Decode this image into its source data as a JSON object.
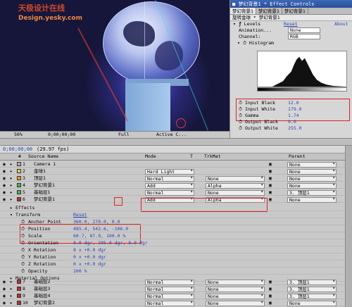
{
  "watermark": {
    "line1": "天极设计在线",
    "line2": "Design.yesky.com"
  },
  "composition": {
    "zoom": "50%",
    "timecode": "0;00;00;00",
    "quality": "Full",
    "camera": "Active C..."
  },
  "effect_controls": {
    "title": "梦幻背景1 * Effect Controls",
    "tabs": [
      "梦幻背景1",
      "梦幻背景1",
      "梦幻背景1"
    ],
    "breadcrumb": "旋转金球 * 梦幻背景1",
    "levels_label": "Levels",
    "reset": "Reset",
    "about": "About",
    "animation_presets_label": "Animation...",
    "animation_presets_value": "None",
    "channel_label": "Channel:",
    "channel_value": "RGB",
    "histogram_label": "Histogram",
    "params": [
      {
        "label": "Input Black",
        "value": "12.0"
      },
      {
        "label": "Input White",
        "value": "179.0"
      },
      {
        "label": "Gamma",
        "value": "1.74"
      },
      {
        "label": "Output Black",
        "value": "0.0"
      },
      {
        "label": "Output White",
        "value": "255.0"
      }
    ]
  },
  "timeline": {
    "time": "0;00;00;00",
    "fps": "(29.97 fps)",
    "columns": {
      "num": "#",
      "source": "Source Name",
      "mode": "Mode",
      "t": "T",
      "trkmat": "TrkMat",
      "parent": "Parent"
    },
    "layers": [
      {
        "num": "1",
        "name": "Camera 1",
        "mode": "",
        "trkmat": "",
        "parent": "None",
        "color": "#c8a4a4"
      },
      {
        "num": "2",
        "name": "金球1",
        "mode": "Hard Light",
        "trkmat": "",
        "parent": "None",
        "color": "#e6c84a"
      },
      {
        "num": "3",
        "name": "顶层1",
        "mode": "Normal",
        "trkmat": "None",
        "parent": "None",
        "color": "#ff9a00"
      },
      {
        "num": "4",
        "name": "梦幻背景1",
        "mode": "Add",
        "trkmat": "Alpha",
        "parent": "None",
        "color": "#48b848"
      },
      {
        "num": "5",
        "name": "基础层1",
        "mode": "Normal",
        "trkmat": "None",
        "parent": "3. 顶层1",
        "color": "#48b848"
      },
      {
        "num": "6",
        "name": "梦幻背景1",
        "mode": "Add",
        "trkmat": "Alpha",
        "parent": "None",
        "color": "#c03030"
      }
    ],
    "effects_label": "Effects",
    "transform_label": "Transform",
    "transform_reset": "Reset",
    "properties": [
      {
        "label": "Anchor Point",
        "value": "360.0, 270.0, 0.0"
      },
      {
        "label": "Position",
        "value": "485.4, 542.6, -106.0"
      },
      {
        "label": "Scale",
        "value": "60.7, 87.9, 100.0 %"
      },
      {
        "label": "Orientation",
        "value": "0.0 dgr, 295.0 dgr, 0.0 dgr"
      },
      {
        "label": "X Rotation",
        "value": "0 x +0.0 dgr"
      },
      {
        "label": "Y Rotation",
        "value": "0 x +0.0 dgr"
      },
      {
        "label": "Z Rotation",
        "value": "0 x +0.0 dgr"
      },
      {
        "label": "Opacity",
        "value": "100 %"
      }
    ],
    "material_label": "Material Options",
    "bottom_layers": [
      {
        "num": "7",
        "name": "基础层2",
        "mode": "Normal",
        "trkmat": "None",
        "parent": "3. 顶层1",
        "color": "#c03030"
      },
      {
        "num": "8",
        "name": "基础层3",
        "mode": "Normal",
        "trkmat": "None",
        "parent": "3. 顶层1",
        "color": "#c03030"
      },
      {
        "num": "9",
        "name": "基础层4",
        "mode": "Normal",
        "trkmat": "None",
        "parent": "3. 顶层1",
        "color": "#c03030"
      },
      {
        "num": "10",
        "name": "梦幻背景2",
        "mode": "Normal",
        "trkmat": "None",
        "parent": "None",
        "color": "#c03030"
      }
    ]
  }
}
